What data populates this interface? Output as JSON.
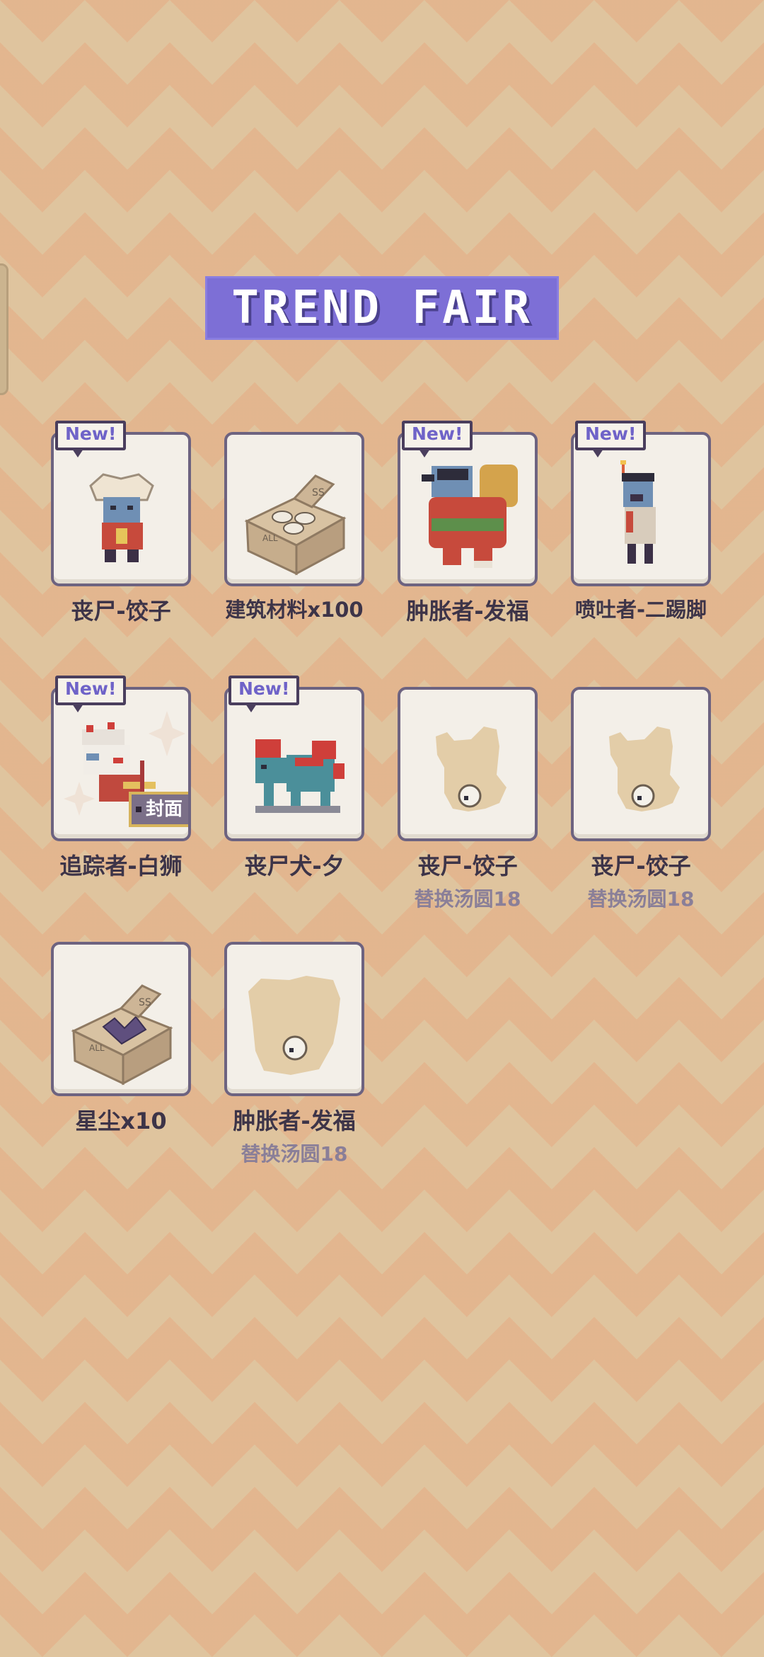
{
  "event": {
    "title": "TREND FAIR"
  },
  "badges": {
    "new": "New!",
    "cover": "封面"
  },
  "items": [
    {
      "name": "丧尸-饺子",
      "sub": "",
      "is_new": true,
      "icon": "zombie-dumpling-icon"
    },
    {
      "name": "建筑材料x100",
      "sub": "",
      "is_new": false,
      "icon": "material-crate-icon"
    },
    {
      "name": "肿胀者-发福",
      "sub": "",
      "is_new": true,
      "icon": "bloater-fortune-icon"
    },
    {
      "name": "喷吐者-二踢脚",
      "sub": "",
      "is_new": true,
      "icon": "spitter-firecracker-icon"
    },
    {
      "name": "追踪者-白狮",
      "sub": "",
      "is_new": true,
      "icon": "tracker-white-lion-icon",
      "cover": true
    },
    {
      "name": "丧尸犬-夕",
      "sub": "",
      "is_new": true,
      "icon": "zombie-dog-nian-icon"
    },
    {
      "name": "丧尸-饺子",
      "sub": "替换汤圆18",
      "is_new": false,
      "icon": "silhouette-tangyuan-icon"
    },
    {
      "name": "丧尸-饺子",
      "sub": "替换汤圆18",
      "is_new": false,
      "icon": "silhouette-tangyuan-icon"
    },
    {
      "name": "星尘x10",
      "sub": "",
      "is_new": false,
      "icon": "stardust-crate-icon"
    },
    {
      "name": "肿胀者-发福",
      "sub": "替换汤圆18",
      "is_new": false,
      "icon": "silhouette-tangyuan-icon"
    }
  ],
  "colors": {
    "background": "#dfc49e",
    "zigzag": "#e8a37c",
    "banner": "#7d6fd6",
    "card_border": "#6d6380",
    "card_fill": "#f3efe8",
    "name_text": "#3d3448",
    "sub_text": "#8a7f98"
  }
}
